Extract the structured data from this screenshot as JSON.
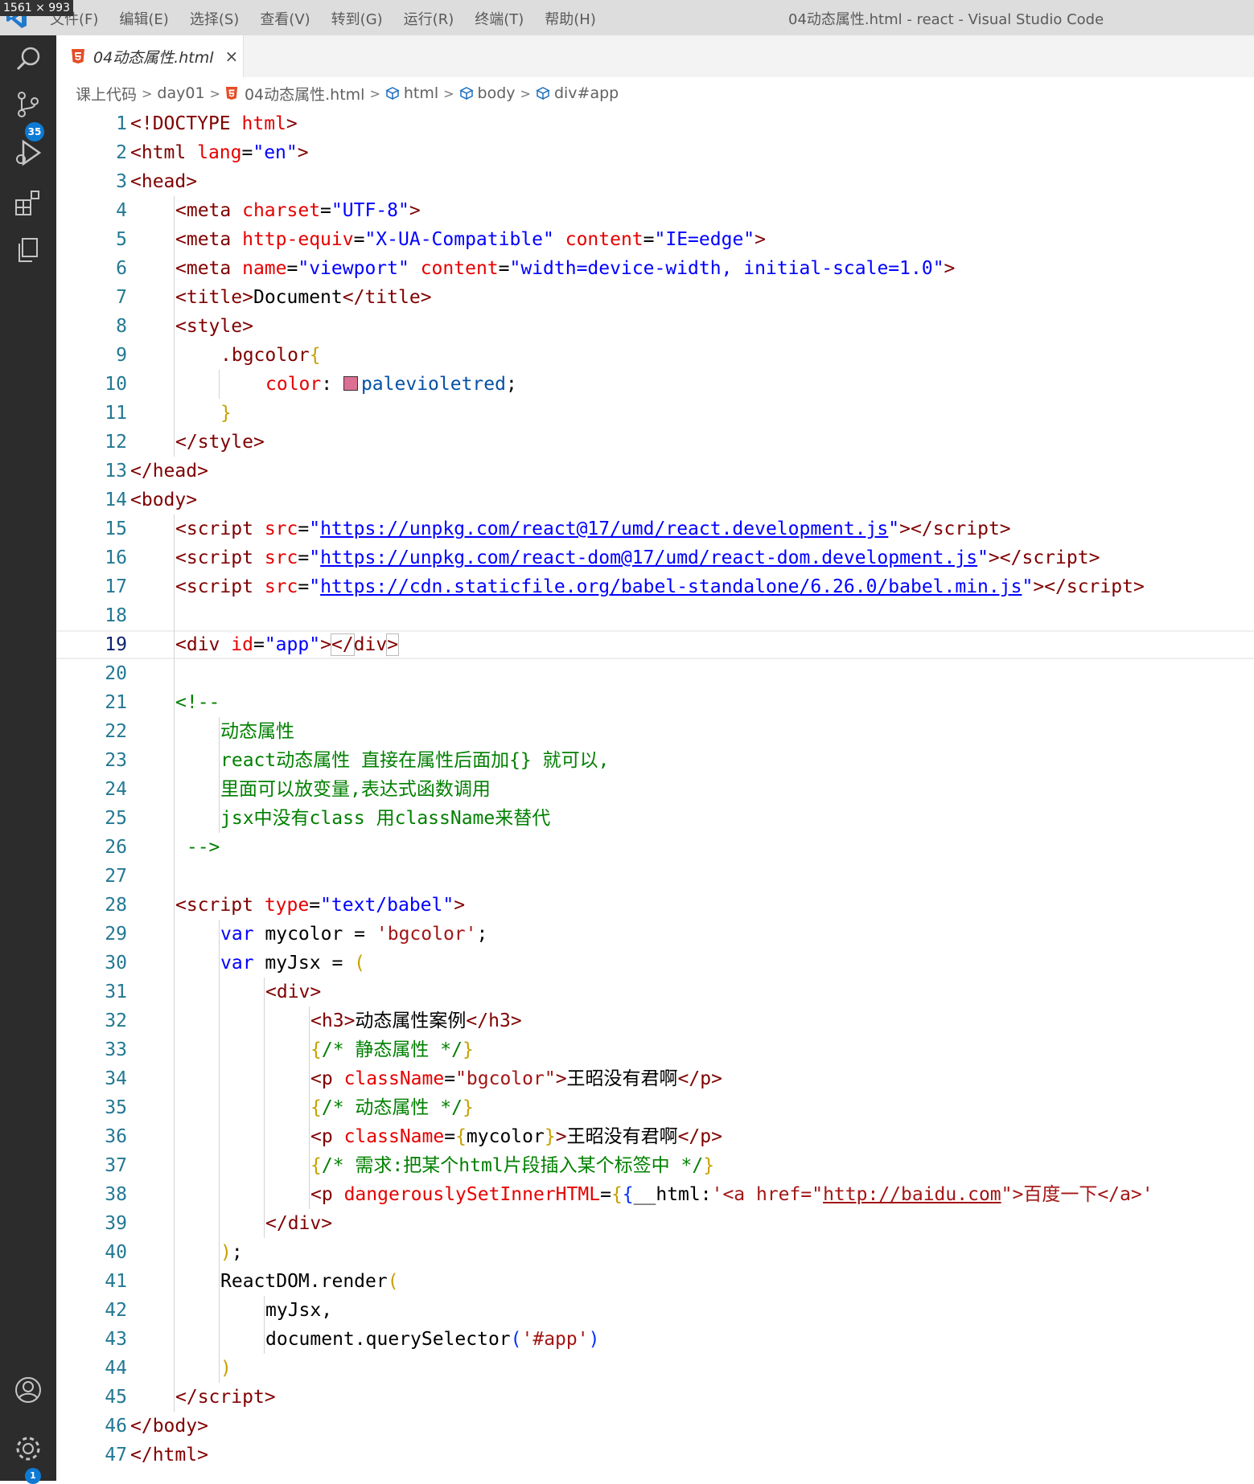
{
  "screen_badge": "1561 × 993",
  "menu": [
    "文件(F)",
    "编辑(E)",
    "选择(S)",
    "查看(V)",
    "转到(G)",
    "运行(R)",
    "终端(T)",
    "帮助(H)"
  ],
  "window_title": "04动态属性.html - react - Visual Studio Code",
  "activity": {
    "scm_badge": "35",
    "settings_badge": "1"
  },
  "tab": {
    "label": "04动态属性.html",
    "close": "×"
  },
  "breadcrumb": [
    "课上代码",
    "day01",
    "04动态属性.html",
    "html",
    "body",
    "div#app"
  ],
  "colors": {
    "accent": "#0e7ad3",
    "swatch": "#db7093"
  },
  "lines": [
    {
      "n": "1",
      "indent": 0,
      "tokens": [
        [
          "p",
          "<!"
        ],
        [
          "t",
          "DOCTYPE"
        ],
        [
          "b",
          " "
        ],
        [
          "a",
          "html"
        ],
        [
          "p",
          ">"
        ]
      ]
    },
    {
      "n": "2",
      "indent": 0,
      "tokens": [
        [
          "p",
          "<"
        ],
        [
          "t",
          "html"
        ],
        [
          "b",
          " "
        ],
        [
          "a",
          "lang"
        ],
        [
          "b",
          "="
        ],
        [
          "v",
          "\"en\""
        ],
        [
          "p",
          ">"
        ]
      ]
    },
    {
      "n": "3",
      "indent": 0,
      "tokens": [
        [
          "p",
          "<"
        ],
        [
          "t",
          "head"
        ],
        [
          "p",
          ">"
        ]
      ]
    },
    {
      "n": "4",
      "indent": 1,
      "tokens": [
        [
          "p",
          "<"
        ],
        [
          "t",
          "meta"
        ],
        [
          "b",
          " "
        ],
        [
          "a",
          "charset"
        ],
        [
          "b",
          "="
        ],
        [
          "v",
          "\"UTF-8\""
        ],
        [
          "p",
          ">"
        ]
      ]
    },
    {
      "n": "5",
      "indent": 1,
      "tokens": [
        [
          "p",
          "<"
        ],
        [
          "t",
          "meta"
        ],
        [
          "b",
          " "
        ],
        [
          "a",
          "http-equiv"
        ],
        [
          "b",
          "="
        ],
        [
          "v",
          "\"X-UA-Compatible\""
        ],
        [
          "b",
          " "
        ],
        [
          "a",
          "content"
        ],
        [
          "b",
          "="
        ],
        [
          "v",
          "\"IE=edge\""
        ],
        [
          "p",
          ">"
        ]
      ]
    },
    {
      "n": "6",
      "indent": 1,
      "tokens": [
        [
          "p",
          "<"
        ],
        [
          "t",
          "meta"
        ],
        [
          "b",
          " "
        ],
        [
          "a",
          "name"
        ],
        [
          "b",
          "="
        ],
        [
          "v",
          "\"viewport\""
        ],
        [
          "b",
          " "
        ],
        [
          "a",
          "content"
        ],
        [
          "b",
          "="
        ],
        [
          "v",
          "\"width=device-width, initial-scale=1.0\""
        ],
        [
          "p",
          ">"
        ]
      ]
    },
    {
      "n": "7",
      "indent": 1,
      "tokens": [
        [
          "p",
          "<"
        ],
        [
          "t",
          "title"
        ],
        [
          "p",
          ">"
        ],
        [
          "b",
          "Document"
        ],
        [
          "p",
          "</"
        ],
        [
          "t",
          "title"
        ],
        [
          "p",
          ">"
        ]
      ]
    },
    {
      "n": "8",
      "indent": 1,
      "tokens": [
        [
          "p",
          "<"
        ],
        [
          "t",
          "style"
        ],
        [
          "p",
          ">"
        ]
      ]
    },
    {
      "n": "9",
      "indent": 2,
      "tokens": [
        [
          "sel",
          ".bgcolor"
        ],
        [
          "by",
          "{"
        ]
      ]
    },
    {
      "n": "10",
      "indent": 3,
      "tokens": [
        [
          "prop",
          "color"
        ],
        [
          "b",
          ": "
        ],
        [
          "swatch",
          ""
        ],
        [
          "pv",
          "palevioletred"
        ],
        [
          "b",
          ";"
        ]
      ]
    },
    {
      "n": "11",
      "indent": 2,
      "tokens": [
        [
          "by",
          "}"
        ]
      ]
    },
    {
      "n": "12",
      "indent": 1,
      "tokens": [
        [
          "p",
          "</"
        ],
        [
          "t",
          "style"
        ],
        [
          "p",
          ">"
        ]
      ]
    },
    {
      "n": "13",
      "indent": 0,
      "tokens": [
        [
          "p",
          "</"
        ],
        [
          "t",
          "head"
        ],
        [
          "p",
          ">"
        ]
      ]
    },
    {
      "n": "14",
      "indent": 0,
      "tokens": [
        [
          "p",
          "<"
        ],
        [
          "t",
          "body"
        ],
        [
          "p",
          ">"
        ]
      ]
    },
    {
      "n": "15",
      "indent": 1,
      "tokens": [
        [
          "p",
          "<"
        ],
        [
          "t",
          "script"
        ],
        [
          "b",
          " "
        ],
        [
          "a",
          "src"
        ],
        [
          "b",
          "="
        ],
        [
          "v",
          "\""
        ],
        [
          "u",
          "https://unpkg.com/react@17/umd/react.development.js"
        ],
        [
          "v",
          "\""
        ],
        [
          "p",
          "></"
        ],
        [
          "t",
          "script"
        ],
        [
          "p",
          ">"
        ]
      ]
    },
    {
      "n": "16",
      "indent": 1,
      "tokens": [
        [
          "p",
          "<"
        ],
        [
          "t",
          "script"
        ],
        [
          "b",
          " "
        ],
        [
          "a",
          "src"
        ],
        [
          "b",
          "="
        ],
        [
          "v",
          "\""
        ],
        [
          "u",
          "https://unpkg.com/react-dom@17/umd/react-dom.development.js"
        ],
        [
          "v",
          "\""
        ],
        [
          "p",
          "></"
        ],
        [
          "t",
          "script"
        ],
        [
          "p",
          ">"
        ]
      ]
    },
    {
      "n": "17",
      "indent": 1,
      "tokens": [
        [
          "p",
          "<"
        ],
        [
          "t",
          "script"
        ],
        [
          "b",
          " "
        ],
        [
          "a",
          "src"
        ],
        [
          "b",
          "="
        ],
        [
          "v",
          "\""
        ],
        [
          "u",
          "https://cdn.staticfile.org/babel-standalone/6.26.0/babel.min.js"
        ],
        [
          "v",
          "\""
        ],
        [
          "p",
          "></"
        ],
        [
          "t",
          "script"
        ],
        [
          "p",
          ">"
        ]
      ]
    },
    {
      "n": "18",
      "indent": 0,
      "tokens": []
    },
    {
      "n": "19",
      "indent": 1,
      "current": true,
      "tokens": [
        [
          "p",
          "<"
        ],
        [
          "t",
          "div"
        ],
        [
          "b",
          " "
        ],
        [
          "a",
          "id"
        ],
        [
          "b",
          "="
        ],
        [
          "v",
          "\"app\""
        ],
        [
          "p",
          ">"
        ],
        [
          "match",
          "</"
        ],
        [
          "t",
          "div"
        ],
        [
          "match",
          ">"
        ]
      ]
    },
    {
      "n": "20",
      "indent": 0,
      "tokens": []
    },
    {
      "n": "21",
      "indent": 1,
      "tokens": [
        [
          "c",
          "<!--"
        ]
      ]
    },
    {
      "n": "22",
      "indent": 2,
      "tokens": [
        [
          "c",
          "动态属性"
        ]
      ]
    },
    {
      "n": "23",
      "indent": 2,
      "tokens": [
        [
          "c",
          "react动态属性 直接在属性后面加{} 就可以,"
        ]
      ]
    },
    {
      "n": "24",
      "indent": 2,
      "tokens": [
        [
          "c",
          "里面可以放变量,表达式函数调用"
        ]
      ]
    },
    {
      "n": "25",
      "indent": 2,
      "tokens": [
        [
          "c",
          "jsx中没有class 用className来替代"
        ]
      ]
    },
    {
      "n": "26",
      "indent": 1,
      "tokens": [
        [
          "c",
          " -->"
        ]
      ]
    },
    {
      "n": "27",
      "indent": 0,
      "tokens": []
    },
    {
      "n": "28",
      "indent": 1,
      "tokens": [
        [
          "p",
          "<"
        ],
        [
          "t",
          "script"
        ],
        [
          "b",
          " "
        ],
        [
          "a",
          "type"
        ],
        [
          "b",
          "="
        ],
        [
          "v",
          "\"text/babel\""
        ],
        [
          "p",
          ">"
        ]
      ]
    },
    {
      "n": "29",
      "indent": 2,
      "tokens": [
        [
          "k",
          "var"
        ],
        [
          "b",
          " mycolor = "
        ],
        [
          "s",
          "'bgcolor'"
        ],
        [
          "b",
          ";"
        ]
      ]
    },
    {
      "n": "30",
      "indent": 2,
      "tokens": [
        [
          "k",
          "var"
        ],
        [
          "b",
          " myJsx = "
        ],
        [
          "by",
          "("
        ]
      ]
    },
    {
      "n": "31",
      "indent": 3,
      "tokens": [
        [
          "p",
          "<"
        ],
        [
          "t",
          "div"
        ],
        [
          "p",
          ">"
        ]
      ]
    },
    {
      "n": "32",
      "indent": 4,
      "tokens": [
        [
          "p",
          "<"
        ],
        [
          "t",
          "h3"
        ],
        [
          "p",
          ">"
        ],
        [
          "b",
          "动态属性案例"
        ],
        [
          "p",
          "</"
        ],
        [
          "t",
          "h3"
        ],
        [
          "p",
          ">"
        ]
      ]
    },
    {
      "n": "33",
      "indent": 4,
      "tokens": [
        [
          "by",
          "{"
        ],
        [
          "c",
          "/* 静态属性 */"
        ],
        [
          "by",
          "}"
        ]
      ]
    },
    {
      "n": "34",
      "indent": 4,
      "tokens": [
        [
          "p",
          "<"
        ],
        [
          "t",
          "p"
        ],
        [
          "b",
          " "
        ],
        [
          "a",
          "className"
        ],
        [
          "b",
          "="
        ],
        [
          "s",
          "\"bgcolor\""
        ],
        [
          "p",
          ">"
        ],
        [
          "b",
          "王昭没有君啊"
        ],
        [
          "p",
          "</"
        ],
        [
          "t",
          "p"
        ],
        [
          "p",
          ">"
        ]
      ]
    },
    {
      "n": "35",
      "indent": 4,
      "tokens": [
        [
          "by",
          "{"
        ],
        [
          "c",
          "/* 动态属性 */"
        ],
        [
          "by",
          "}"
        ]
      ]
    },
    {
      "n": "36",
      "indent": 4,
      "tokens": [
        [
          "p",
          "<"
        ],
        [
          "t",
          "p"
        ],
        [
          "b",
          " "
        ],
        [
          "a",
          "className"
        ],
        [
          "b",
          "="
        ],
        [
          "by",
          "{"
        ],
        [
          "b",
          "mycolor"
        ],
        [
          "by",
          "}"
        ],
        [
          "p",
          ">"
        ],
        [
          "b",
          "王昭没有君啊"
        ],
        [
          "p",
          "</"
        ],
        [
          "t",
          "p"
        ],
        [
          "p",
          ">"
        ]
      ]
    },
    {
      "n": "37",
      "indent": 4,
      "tokens": [
        [
          "by",
          "{"
        ],
        [
          "c",
          "/* 需求:把某个html片段插入某个标签中 */"
        ],
        [
          "by",
          "}"
        ]
      ]
    },
    {
      "n": "38",
      "indent": 4,
      "tokens": [
        [
          "p",
          "<"
        ],
        [
          "t",
          "p"
        ],
        [
          "b",
          " "
        ],
        [
          "a",
          "dangerouslySetInnerHTML"
        ],
        [
          "b",
          "="
        ],
        [
          "by",
          "{"
        ],
        [
          "br",
          "{"
        ],
        [
          "b",
          "__html:"
        ],
        [
          "s",
          "'<a href=\""
        ],
        [
          "us",
          "http://baidu.com"
        ],
        [
          "s",
          "\">百度一下</a>'"
        ]
      ]
    },
    {
      "n": "39",
      "indent": 3,
      "tokens": [
        [
          "p",
          "</"
        ],
        [
          "t",
          "div"
        ],
        [
          "p",
          ">"
        ]
      ]
    },
    {
      "n": "40",
      "indent": 2,
      "tokens": [
        [
          "by",
          ")"
        ],
        [
          "b",
          ";"
        ]
      ]
    },
    {
      "n": "41",
      "indent": 2,
      "tokens": [
        [
          "b",
          "ReactDOM.render"
        ],
        [
          "by",
          "("
        ]
      ]
    },
    {
      "n": "42",
      "indent": 3,
      "tokens": [
        [
          "b",
          "myJsx,"
        ]
      ]
    },
    {
      "n": "43",
      "indent": 3,
      "tokens": [
        [
          "b",
          "document.querySelector"
        ],
        [
          "br",
          "("
        ],
        [
          "s",
          "'#app'"
        ],
        [
          "br",
          ")"
        ]
      ]
    },
    {
      "n": "44",
      "indent": 2,
      "tokens": [
        [
          "by",
          ")"
        ]
      ]
    },
    {
      "n": "45",
      "indent": 1,
      "tokens": [
        [
          "p",
          "</"
        ],
        [
          "t",
          "script"
        ],
        [
          "p",
          ">"
        ]
      ]
    },
    {
      "n": "46",
      "indent": 0,
      "tokens": [
        [
          "p",
          "</"
        ],
        [
          "t",
          "body"
        ],
        [
          "p",
          ">"
        ]
      ]
    },
    {
      "n": "47",
      "indent": 0,
      "tokens": [
        [
          "p",
          "</"
        ],
        [
          "t",
          "html"
        ],
        [
          "p",
          ">"
        ]
      ]
    }
  ]
}
